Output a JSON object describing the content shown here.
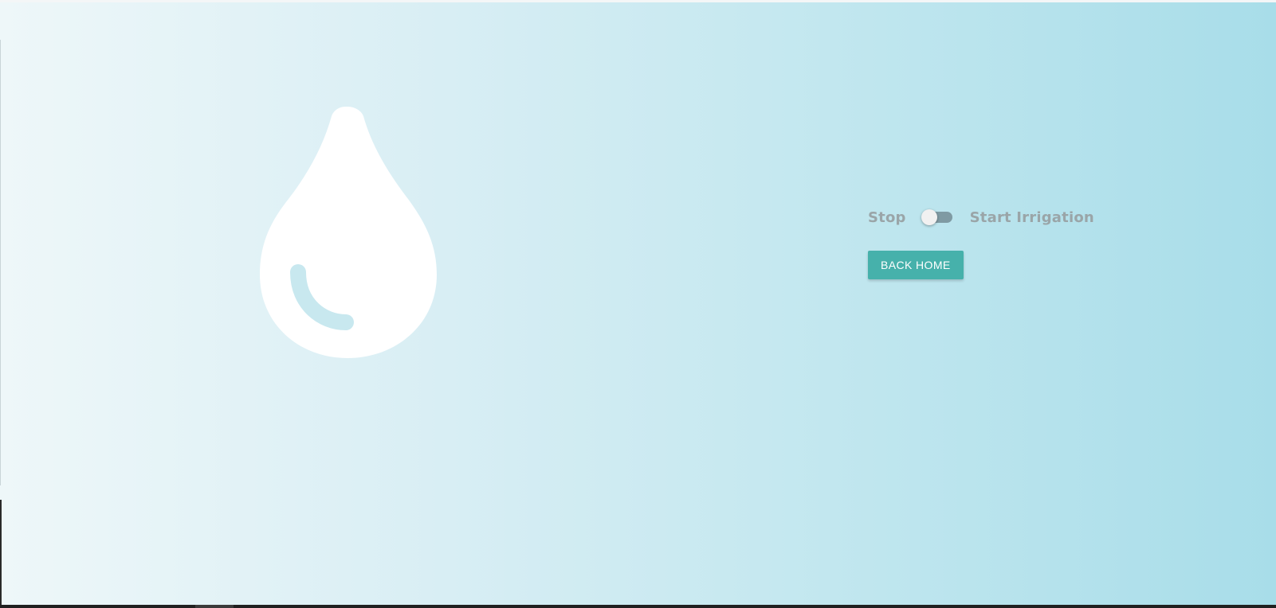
{
  "colors": {
    "gradient_start": "#eef7f9",
    "gradient_end": "#a8dde9",
    "drop_fill": "#ffffff",
    "drop_highlight": "#c8e8ef",
    "label_text": "#9aa5a8",
    "switch_track": "#7f9aa3",
    "switch_knob": "#f1f1f1",
    "button_bg": "#46b1ab",
    "button_text": "#ffffff"
  },
  "illustration": {
    "icon": "water-drop-icon"
  },
  "irrigation_switch": {
    "off_label": "Stop",
    "on_label": "Start Irrigation",
    "state": "off"
  },
  "back_button": {
    "label": "BACK HOME"
  }
}
